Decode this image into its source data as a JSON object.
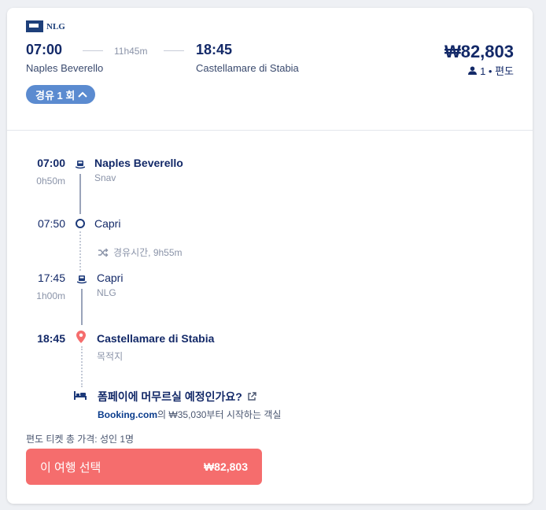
{
  "operator": {
    "logo_text": "NLG"
  },
  "summary": {
    "depart_time": "07:00",
    "duration": "11h45m",
    "arrive_time": "18:45",
    "depart_place": "Naples Beverello",
    "arrive_place": "Castellamare di Stabia",
    "price": "₩82,803",
    "pax": "1 • 편도"
  },
  "stops_pill": {
    "label": "경유 1 회"
  },
  "timeline": {
    "seg1": {
      "time": "07:00",
      "duration": "0h50m",
      "station": "Naples Beverello",
      "operator": "Snav"
    },
    "stop1": {
      "time": "07:50",
      "station": "Capri"
    },
    "layover": "경유시간, 9h55m",
    "seg2": {
      "time": "17:45",
      "duration": "1h00m",
      "station": "Capri",
      "operator": "NLG"
    },
    "arrival": {
      "time": "18:45",
      "station": "Castellamare di Stabia",
      "note": "목적지"
    }
  },
  "hotel": {
    "title": "폼페이에 머무르실 예정인가요?",
    "brand": "Booking.com",
    "text": "의 ₩35,030부터 시작하는 객실"
  },
  "total_label": "편도 티켓 총 가격: 성인 1명",
  "select_button": {
    "label": "이 여행 선택",
    "amount": "₩82,803"
  }
}
